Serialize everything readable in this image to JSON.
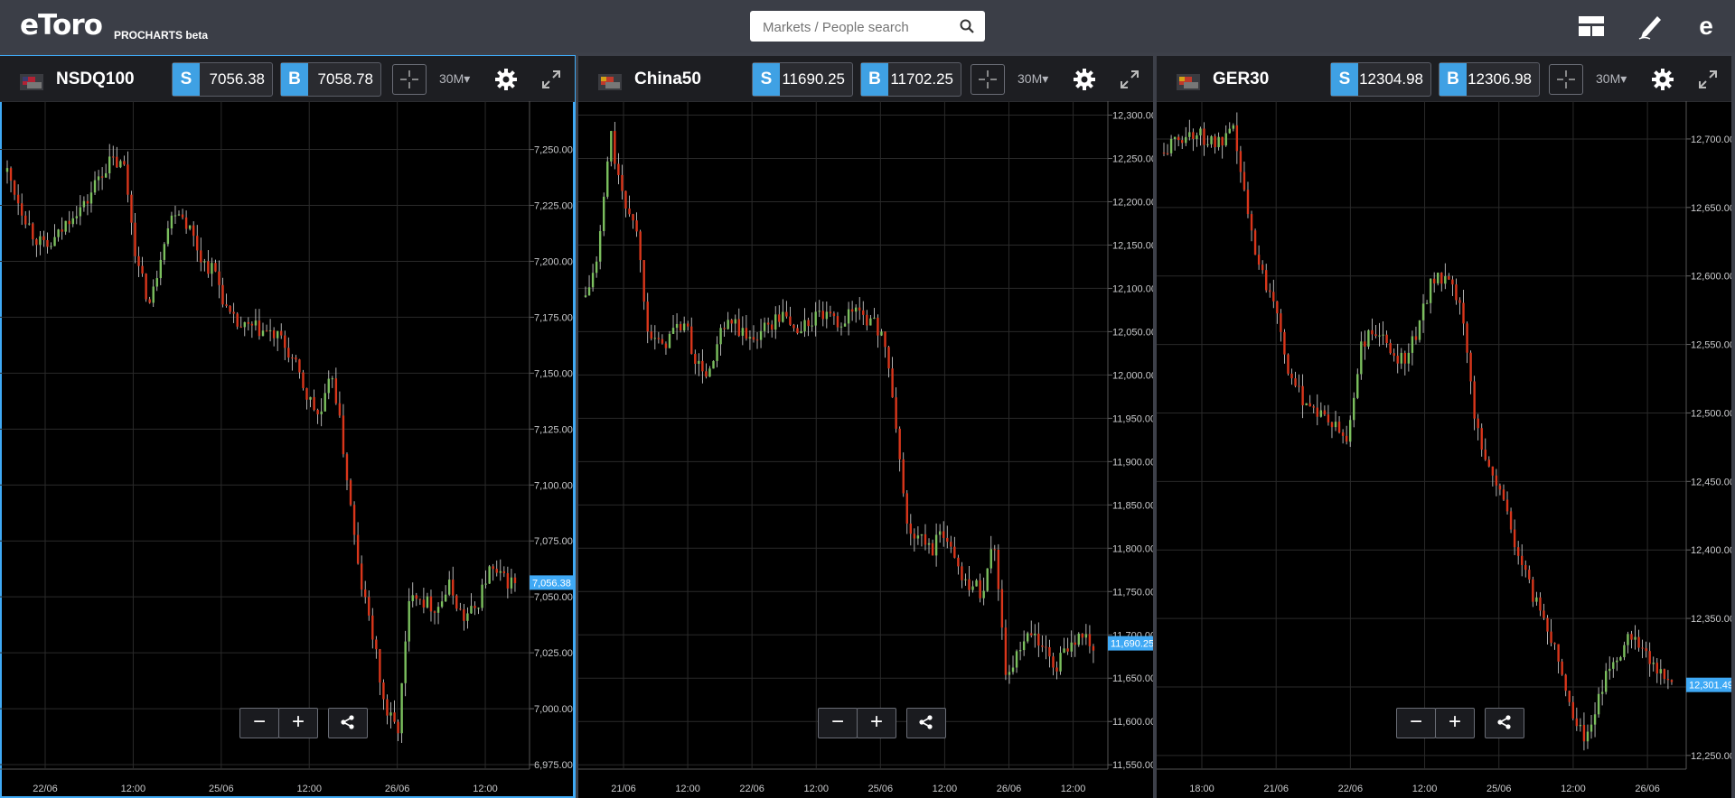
{
  "header": {
    "logo": "eToro",
    "subtitle": "PROCHARTS beta",
    "search_placeholder": "Markets / People search"
  },
  "panels": [
    {
      "instrument": "NSDQ100",
      "sell_label": "S",
      "sell": "7056.38",
      "buy_label": "B",
      "buy": "7058.78",
      "timeframe": "30M",
      "active": true,
      "current_price_label": "7,056.38",
      "current_price": 7056.38,
      "y_ticks": [
        "7,250.00",
        "7,225.00",
        "7,200.00",
        "7,175.00",
        "7,150.00",
        "7,125.00",
        "7,100.00",
        "7,075.00",
        "7,050.00",
        "7,025.00",
        "7,000.00",
        "6,975.00"
      ],
      "y_range": [
        6973,
        7270
      ],
      "x_labels": [
        "22/06",
        "12:00",
        "25/06",
        "12:00",
        "26/06",
        "12:00"
      ],
      "path": [
        7240,
        7225,
        7212,
        7205,
        7212,
        7222,
        7225,
        7238,
        7245,
        7242,
        7198,
        7180,
        7210,
        7225,
        7215,
        7200,
        7195,
        7175,
        7170,
        7170,
        7168,
        7165,
        7155,
        7140,
        7130,
        7150,
        7108,
        7060,
        7035,
        7000,
        6990,
        7055,
        7048,
        7045,
        7055,
        7040,
        7045,
        7062,
        7058,
        7056
      ]
    },
    {
      "instrument": "China50",
      "sell_label": "S",
      "sell": "11690.25",
      "buy_label": "B",
      "buy": "11702.25",
      "timeframe": "30M",
      "active": false,
      "current_price_label": "11,690.25",
      "current_price": 11690.25,
      "y_ticks": [
        "12,300.00",
        "12,250.00",
        "12,200.00",
        "12,150.00",
        "12,100.00",
        "12,050.00",
        "12,000.00",
        "11,950.00",
        "11,900.00",
        "11,850.00",
        "11,800.00",
        "11,750.00",
        "11,700.00",
        "11,650.00",
        "11,600.00",
        "11,550.00"
      ],
      "y_range": [
        11545,
        12312
      ],
      "x_labels": [
        "21/06",
        "12:00",
        "22/06",
        "12:00",
        "25/06",
        "12:00",
        "26/06",
        "12:00"
      ],
      "path": [
        12090,
        12135,
        12280,
        12200,
        12180,
        12060,
        12030,
        12050,
        12060,
        12010,
        12000,
        12050,
        12060,
        12040,
        12050,
        12060,
        12070,
        12050,
        12060,
        12070,
        12060,
        12065,
        12080,
        12060,
        12050,
        11950,
        11820,
        11810,
        11800,
        11820,
        11780,
        11760,
        11750,
        11810,
        11650,
        11680,
        11700,
        11680,
        11660,
        11690,
        11700,
        11690
      ]
    },
    {
      "instrument": "GER30",
      "sell_label": "S",
      "sell": "12304.98",
      "buy_label": "B",
      "buy": "12306.98",
      "timeframe": "30M",
      "active": false,
      "current_price_label": "12,301.49",
      "current_price": 12301.49,
      "y_ticks": [
        "12,700.00",
        "12,650.00",
        "12,600.00",
        "12,550.00",
        "12,500.00",
        "12,450.00",
        "12,400.00",
        "12,350.00",
        "12,300.00",
        "12,250.00"
      ],
      "y_range": [
        12240,
        12725
      ],
      "x_labels": [
        "18:00",
        "21/06",
        "22/06",
        "12:00",
        "25/06",
        "12:00",
        "26/06"
      ],
      "path": [
        12690,
        12700,
        12705,
        12700,
        12695,
        12705,
        12640,
        12600,
        12580,
        12520,
        12510,
        12500,
        12490,
        12480,
        12550,
        12560,
        12545,
        12540,
        12560,
        12600,
        12595,
        12580,
        12500,
        12460,
        12440,
        12400,
        12370,
        12350,
        12320,
        12280,
        12260,
        12300,
        12320,
        12340,
        12330,
        12310,
        12302
      ]
    }
  ]
}
